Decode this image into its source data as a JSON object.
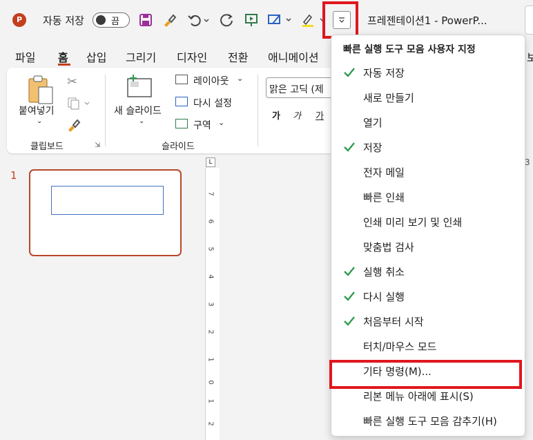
{
  "titlebar": {
    "autosave_label": "자동 저장",
    "autosave_toggle_text": "끔",
    "doc_title": "프레젠테이션1  -  PowerP..."
  },
  "tabs": [
    "파일",
    "홈",
    "삽입",
    "그리기",
    "디자인",
    "전환",
    "애니메이션"
  ],
  "tab_overflow": "보",
  "ribbon": {
    "clipboard": {
      "paste_label": "붙여넣기",
      "group_label": "클립보드"
    },
    "slides": {
      "new_slide_label": "새 슬라이드",
      "layout_label": "레이아웃",
      "reset_label": "다시 설정",
      "section_label": "구역",
      "group_label": "슬라이드"
    },
    "font": {
      "font_name": "맑은 고딕 (제",
      "bold": "가",
      "italic": "가",
      "underline": "가"
    }
  },
  "slide_pane": {
    "slide_number": "1"
  },
  "ruler_numbers": [
    "7",
    "6",
    "5",
    "4",
    "3",
    "2",
    "1",
    "0",
    "1",
    "2"
  ],
  "ruler_corner": "L",
  "ruler_top_right": "3",
  "menu": {
    "title": "빠른 실행 도구 모음 사용자 지정",
    "items": [
      {
        "label": "자동 저장",
        "checked": true
      },
      {
        "label": "새로 만들기",
        "checked": false
      },
      {
        "label": "열기",
        "checked": false
      },
      {
        "label": "저장",
        "checked": true
      },
      {
        "label": "전자 메일",
        "checked": false
      },
      {
        "label": "빠른 인쇄",
        "checked": false
      },
      {
        "label": "인쇄 미리 보기 및 인쇄",
        "checked": false
      },
      {
        "label": "맞춤법 검사",
        "checked": false
      },
      {
        "label": "실행 취소",
        "checked": true
      },
      {
        "label": "다시 실행",
        "checked": true
      },
      {
        "label": "처음부터 시작",
        "checked": true
      },
      {
        "label": "터치/마우스 모드",
        "checked": false
      },
      {
        "label": "기타 명령(M)...",
        "checked": false
      },
      {
        "label": "리본 메뉴 아래에 표시(S)",
        "checked": false
      },
      {
        "label": "빠른 실행 도구 모음 감추기(H)",
        "checked": false
      }
    ]
  },
  "colors": {
    "accent": "#c43e1c",
    "check": "#2e9c4f",
    "highlight_border": "#e0161d"
  }
}
